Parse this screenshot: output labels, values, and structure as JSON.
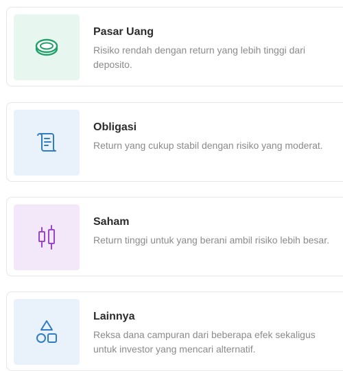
{
  "colors": {
    "pasar_uang_bg": "#e8f6f0",
    "obligasi_bg": "#e9f1fa",
    "saham_bg": "#f3e8f9",
    "lainnya_bg": "#e9f1fa",
    "pasar_uang_icon": "#21a06a",
    "obligasi_icon": "#2f7cc4",
    "saham_icon": "#9a45c8",
    "lainnya_icon": "#2f7cc4"
  },
  "products": [
    {
      "title": "Pasar Uang",
      "description": "Risiko rendah dengan return yang lebih tinggi dari deposito.",
      "icon": "coin-icon"
    },
    {
      "title": "Obligasi",
      "description": "Return yang cukup stabil dengan risiko yang moderat.",
      "icon": "scroll-icon"
    },
    {
      "title": "Saham",
      "description": "Return tinggi untuk yang berani ambil risiko lebih besar.",
      "icon": "candlestick-icon"
    },
    {
      "title": "Lainnya",
      "description": "Reksa dana campuran dari beberapa efek sekaligus untuk investor yang mencari alternatif.",
      "icon": "shapes-icon"
    }
  ]
}
